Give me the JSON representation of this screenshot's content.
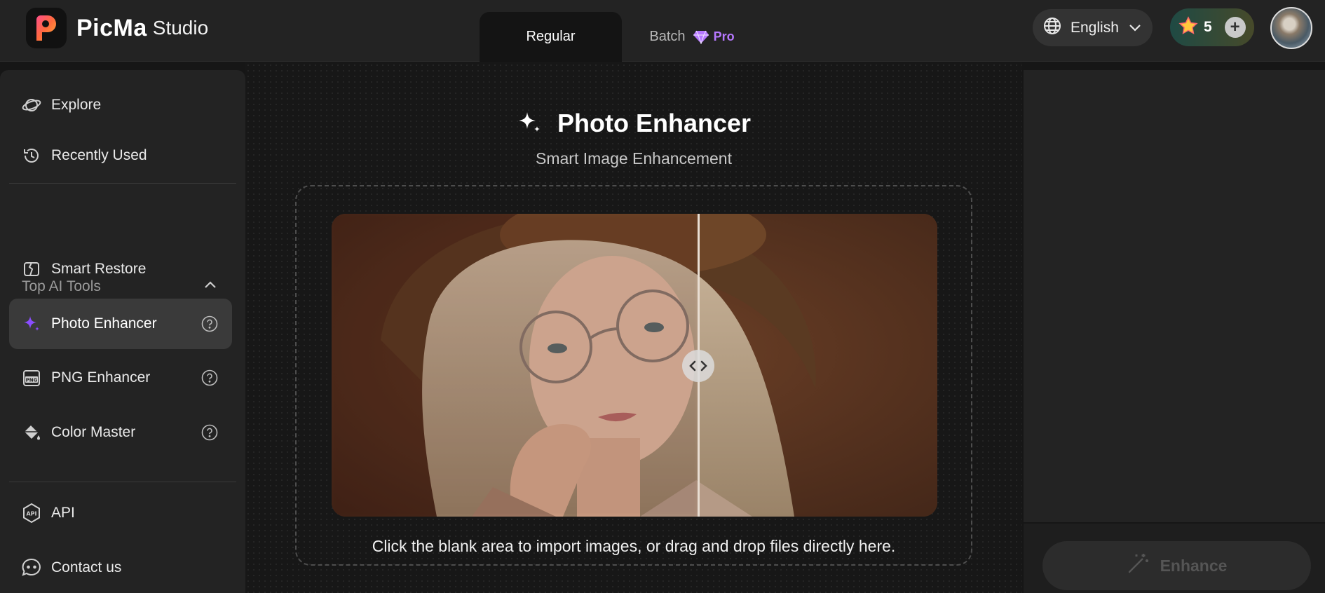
{
  "app": {
    "name": "PicMa",
    "sub": "Studio"
  },
  "mode_tabs": {
    "regular": "Regular",
    "batch": "Batch",
    "pro_badge": "Pro"
  },
  "header": {
    "language": "English",
    "credits": "5"
  },
  "sidebar": {
    "explore": "Explore",
    "recent": "Recently Used",
    "section_title": "Top AI Tools",
    "items": [
      {
        "label": "Smart Restore",
        "icon": "smart-restore-icon"
      },
      {
        "label": "Photo Enhancer",
        "icon": "sparkle-icon",
        "active": true
      },
      {
        "label": "PNG Enhancer",
        "icon": "png-icon"
      },
      {
        "label": "Color Master",
        "icon": "paint-bucket-icon"
      }
    ],
    "api": "API",
    "contact": "Contact us"
  },
  "main": {
    "title": "Photo Enhancer",
    "subtitle": "Smart Image Enhancement",
    "hint": "Click the blank area to import images, or drag and drop files directly here."
  },
  "actions": {
    "enhance": "Enhance"
  },
  "colors": {
    "accent_purple": "#8a4dff",
    "pro_purple": "#b678ff",
    "background": "#161616",
    "panel": "#232323"
  }
}
